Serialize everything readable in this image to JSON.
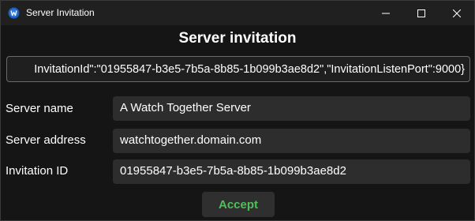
{
  "window": {
    "title": "Server Invitation"
  },
  "heading": "Server invitation",
  "invitation_json": "InvitationId\":\"01955847-b3e5-7b5a-8b85-1b099b3ae8d2\",\"InvitationListenPort\":9000}",
  "fields": {
    "server_name": {
      "label": "Server name",
      "value": "A Watch Together Server"
    },
    "server_address": {
      "label": "Server address",
      "value": "watchtogether.domain.com"
    },
    "invitation_id": {
      "label": "Invitation ID",
      "value": "01955847-b3e5-7b5a-8b85-1b099b3ae8d2"
    }
  },
  "accept_label": "Accept",
  "icons": {
    "app": "app-logo-icon",
    "minimize": "minimize-icon",
    "maximize": "maximize-icon",
    "close": "close-icon"
  },
  "colors": {
    "accent_green": "#4fbf5a",
    "background": "#151515",
    "field_background": "#2d2d2d"
  }
}
